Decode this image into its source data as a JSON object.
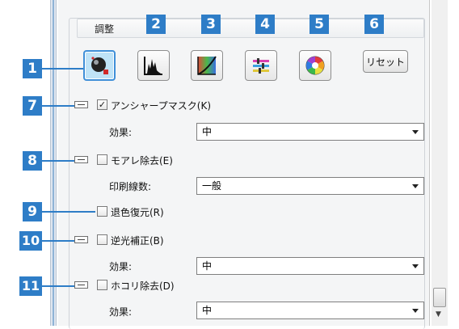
{
  "panel": {
    "group_title": "調整",
    "reset_label": "リセット",
    "tool_icons": [
      "unsharp-mask-icon",
      "histogram-icon",
      "tone-curve-icon",
      "color-balance-icon",
      "color-palette-icon"
    ]
  },
  "callouts": [
    "1",
    "2",
    "3",
    "4",
    "5",
    "6",
    "7",
    "8",
    "9",
    "10",
    "11"
  ],
  "rows": {
    "unsharp": {
      "label": "アンシャープマスク(K)",
      "checked": "✓",
      "field_label": "効果:",
      "value": "中"
    },
    "moire": {
      "label": "モアレ除去(E)",
      "checked": "",
      "field_label": "印刷線数:",
      "value": "一般"
    },
    "fade": {
      "label": "退色復元(R)",
      "checked": ""
    },
    "backlight": {
      "label": "逆光補正(B)",
      "checked": "",
      "field_label": "効果:",
      "value": "中"
    },
    "dust": {
      "label": "ホコリ除去(D)",
      "checked": "",
      "field_label": "効果:",
      "value": "中"
    }
  },
  "colors": {
    "callout_blue": "#2e7dc7",
    "active_border": "#3f8fd8",
    "active_fill": "#bfe3f7"
  }
}
